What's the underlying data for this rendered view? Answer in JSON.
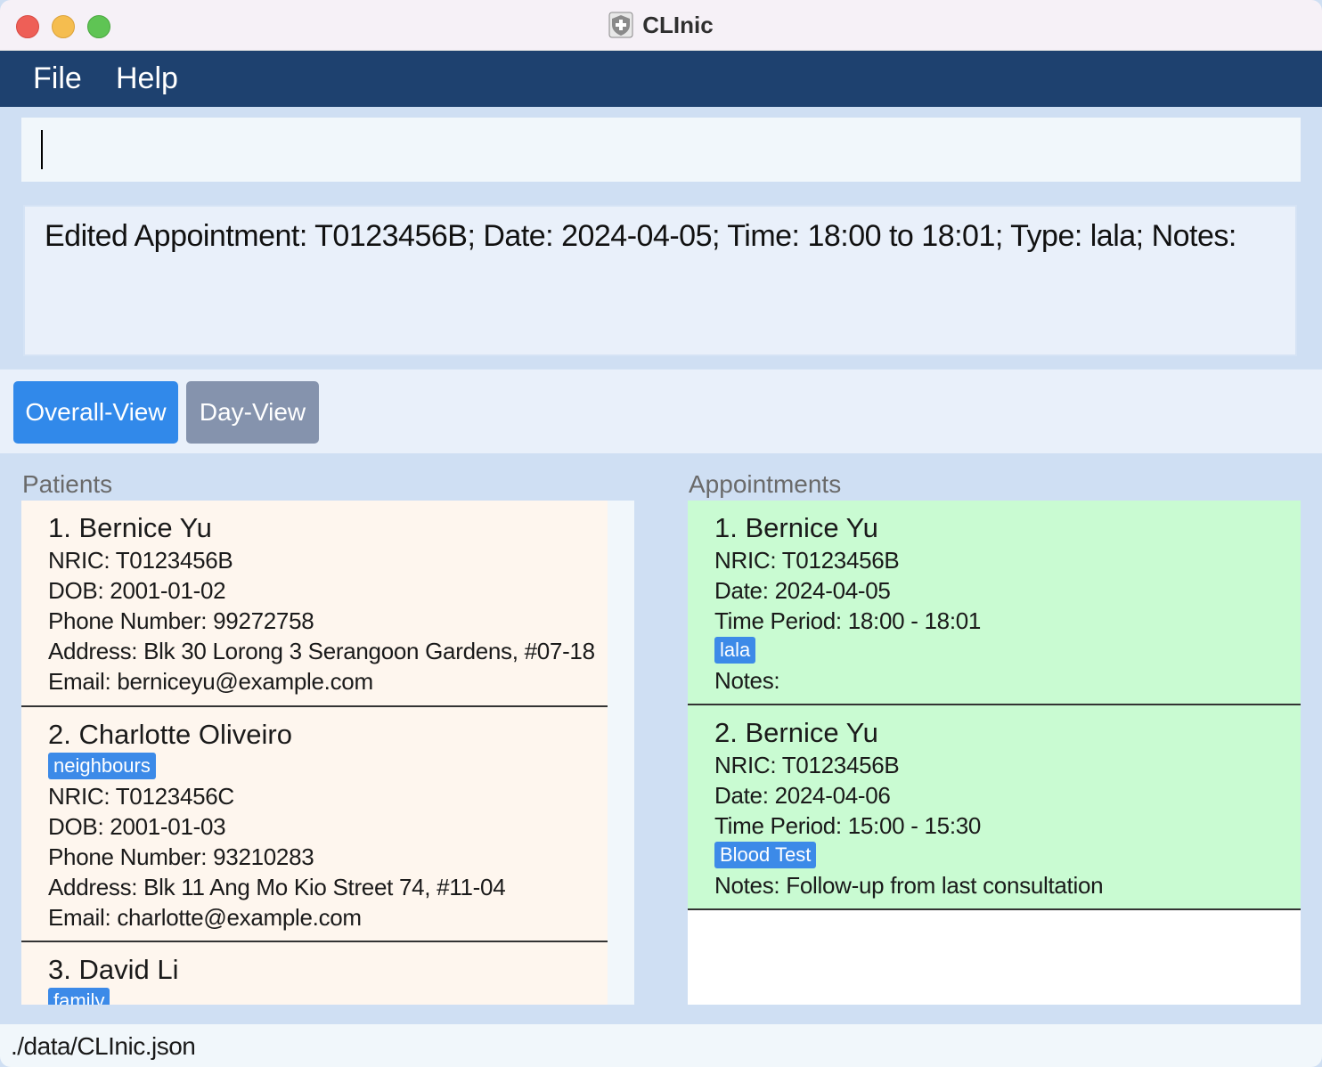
{
  "window": {
    "title": "CLInic"
  },
  "menu": {
    "file": "File",
    "help": "Help"
  },
  "command": {
    "value": ""
  },
  "result": {
    "text": "Edited Appointment: T0123456B; Date: 2024-04-05; Time: 18:00 to 18:01; Type: lala; Notes:"
  },
  "tabs": {
    "overall": "Overall-View",
    "day": "Day-View",
    "active": "Overall-View"
  },
  "patients": {
    "label": "Patients",
    "items": [
      {
        "name": "1.  Bernice Yu",
        "tags": [],
        "nric": "NRIC: T0123456B",
        "dob": "DOB: 2001-01-02",
        "phone": "Phone Number: 99272758",
        "address": "Address: Blk 30 Lorong 3 Serangoon Gardens, #07-18",
        "email": "Email: berniceyu@example.com"
      },
      {
        "name": "2.  Charlotte Oliveiro",
        "tags": [
          "neighbours"
        ],
        "nric": "NRIC: T0123456C",
        "dob": "DOB: 2001-01-03",
        "phone": "Phone Number: 93210283",
        "address": "Address: Blk 11 Ang Mo Kio Street 74, #11-04",
        "email": "Email: charlotte@example.com"
      },
      {
        "name": "3.  David Li",
        "tags": [
          "family"
        ]
      }
    ]
  },
  "appointments": {
    "label": "Appointments",
    "items": [
      {
        "name": "1.  Bernice Yu",
        "nric": "NRIC: T0123456B",
        "date": "Date: 2024-04-05",
        "time": "Time Period: 18:00 - 18:01",
        "type": "lala",
        "notes": "Notes:"
      },
      {
        "name": "2.  Bernice Yu",
        "nric": "NRIC: T0123456B",
        "date": "Date: 2024-04-06",
        "time": "Time Period: 15:00 - 15:30",
        "type": "Blood Test",
        "notes": "Notes: Follow-up from last consultation"
      }
    ]
  },
  "status": {
    "path": "./data/CLInic.json"
  },
  "colors": {
    "menubar": "#1e416f",
    "tab_active": "#3189ea",
    "tab_inactive": "#8593ad",
    "patient_card": "#fef6ee",
    "appointment_card": "#c9fbd2",
    "tag": "#3c8ae8"
  },
  "icons": {
    "app": "shield-cross-icon"
  }
}
